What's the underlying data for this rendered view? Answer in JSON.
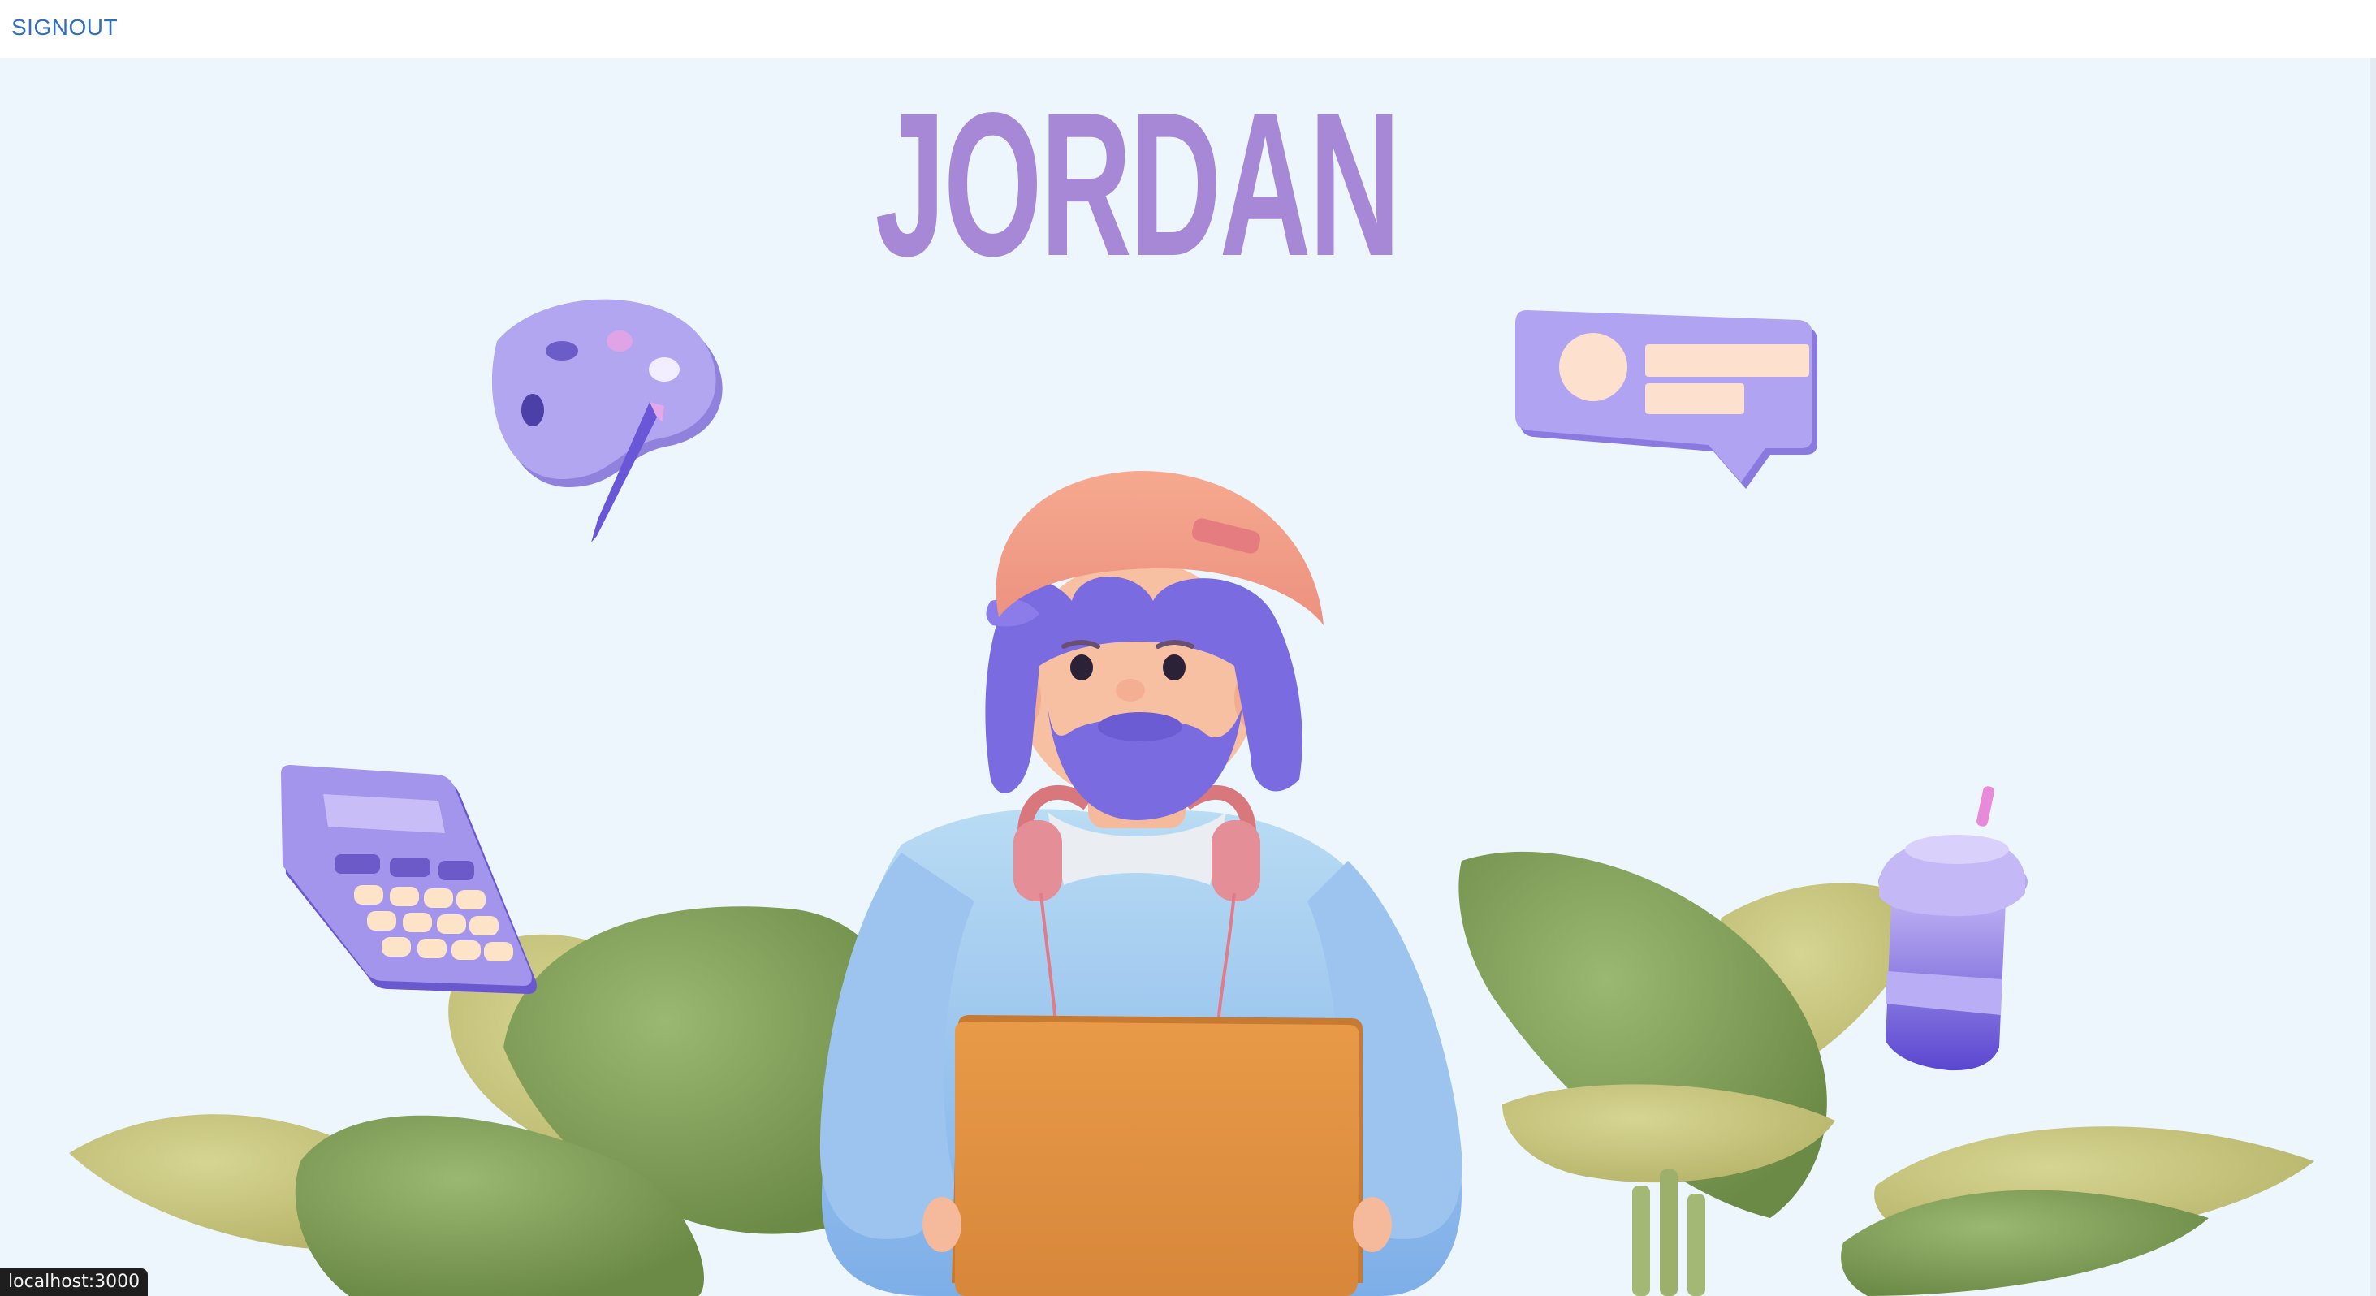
{
  "nav": {
    "signout_label": "SIGNOUT"
  },
  "hero": {
    "name": "JORDAN"
  },
  "status_bar": {
    "url": "localhost:3000"
  },
  "colors": {
    "background": "#eef6fd",
    "title": "#a788d6",
    "link": "#2f6fbd",
    "accent_purple": "#8e7ee0",
    "leaf_green": "#7f9c5a",
    "laptop_orange": "#e0913e"
  },
  "illustration": {
    "character": "3d-avatar-with-laptop",
    "icons": [
      "palette-icon",
      "chat-bubble-icon",
      "calculator-icon",
      "drink-cup-icon"
    ]
  }
}
